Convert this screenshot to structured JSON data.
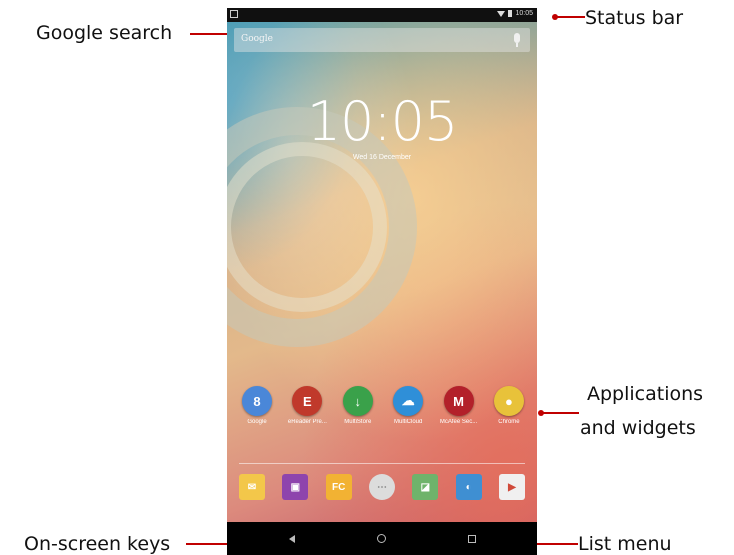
{
  "callouts": {
    "google_search": "Google search",
    "status_bar": "Status bar",
    "applications": "Applications",
    "and_widgets": "and widgets",
    "on_screen_keys": "On-screen keys",
    "list_menu": "List menu"
  },
  "status_bar": {
    "time": "10:05"
  },
  "search": {
    "placeholder": "Google"
  },
  "lockscreen": {
    "clock": "10:05",
    "date": "Wed 16 December"
  },
  "apps": [
    {
      "label": "Google",
      "icon": "google-folder-icon",
      "color": "#4a87d8",
      "glyph": "8"
    },
    {
      "label": "eReader Pre...",
      "icon": "ereader-icon",
      "color": "#c0392b",
      "glyph": "E"
    },
    {
      "label": "MultiStore",
      "icon": "multistore-icon",
      "color": "#3aa14a",
      "glyph": "↓"
    },
    {
      "label": "MultiCloud",
      "icon": "multicloud-icon",
      "color": "#2f8fd8",
      "glyph": "☁"
    },
    {
      "label": "McAfee Sec...",
      "icon": "mcafee-icon",
      "color": "#b3202a",
      "glyph": "M"
    },
    {
      "label": "Chrome",
      "icon": "chrome-icon",
      "color": "#e8c23a",
      "glyph": "●"
    }
  ],
  "dock": [
    {
      "icon": "email-icon",
      "color": "#f3c74a",
      "glyph": "✉"
    },
    {
      "icon": "gallery-icon",
      "color": "#8e44ad",
      "glyph": "▣"
    },
    {
      "icon": "file-commander-icon",
      "color": "#f2b233",
      "glyph": "FC"
    },
    {
      "icon": "app-drawer-icon",
      "color": "#dcdcdc",
      "glyph": "⋯"
    },
    {
      "icon": "maps-icon",
      "color": "#6fb36b",
      "glyph": "◪"
    },
    {
      "icon": "browser-icon",
      "color": "#3f8fd2",
      "glyph": "◐"
    },
    {
      "icon": "play-store-icon",
      "color": "#f0f0f0",
      "glyph": "▶"
    }
  ]
}
